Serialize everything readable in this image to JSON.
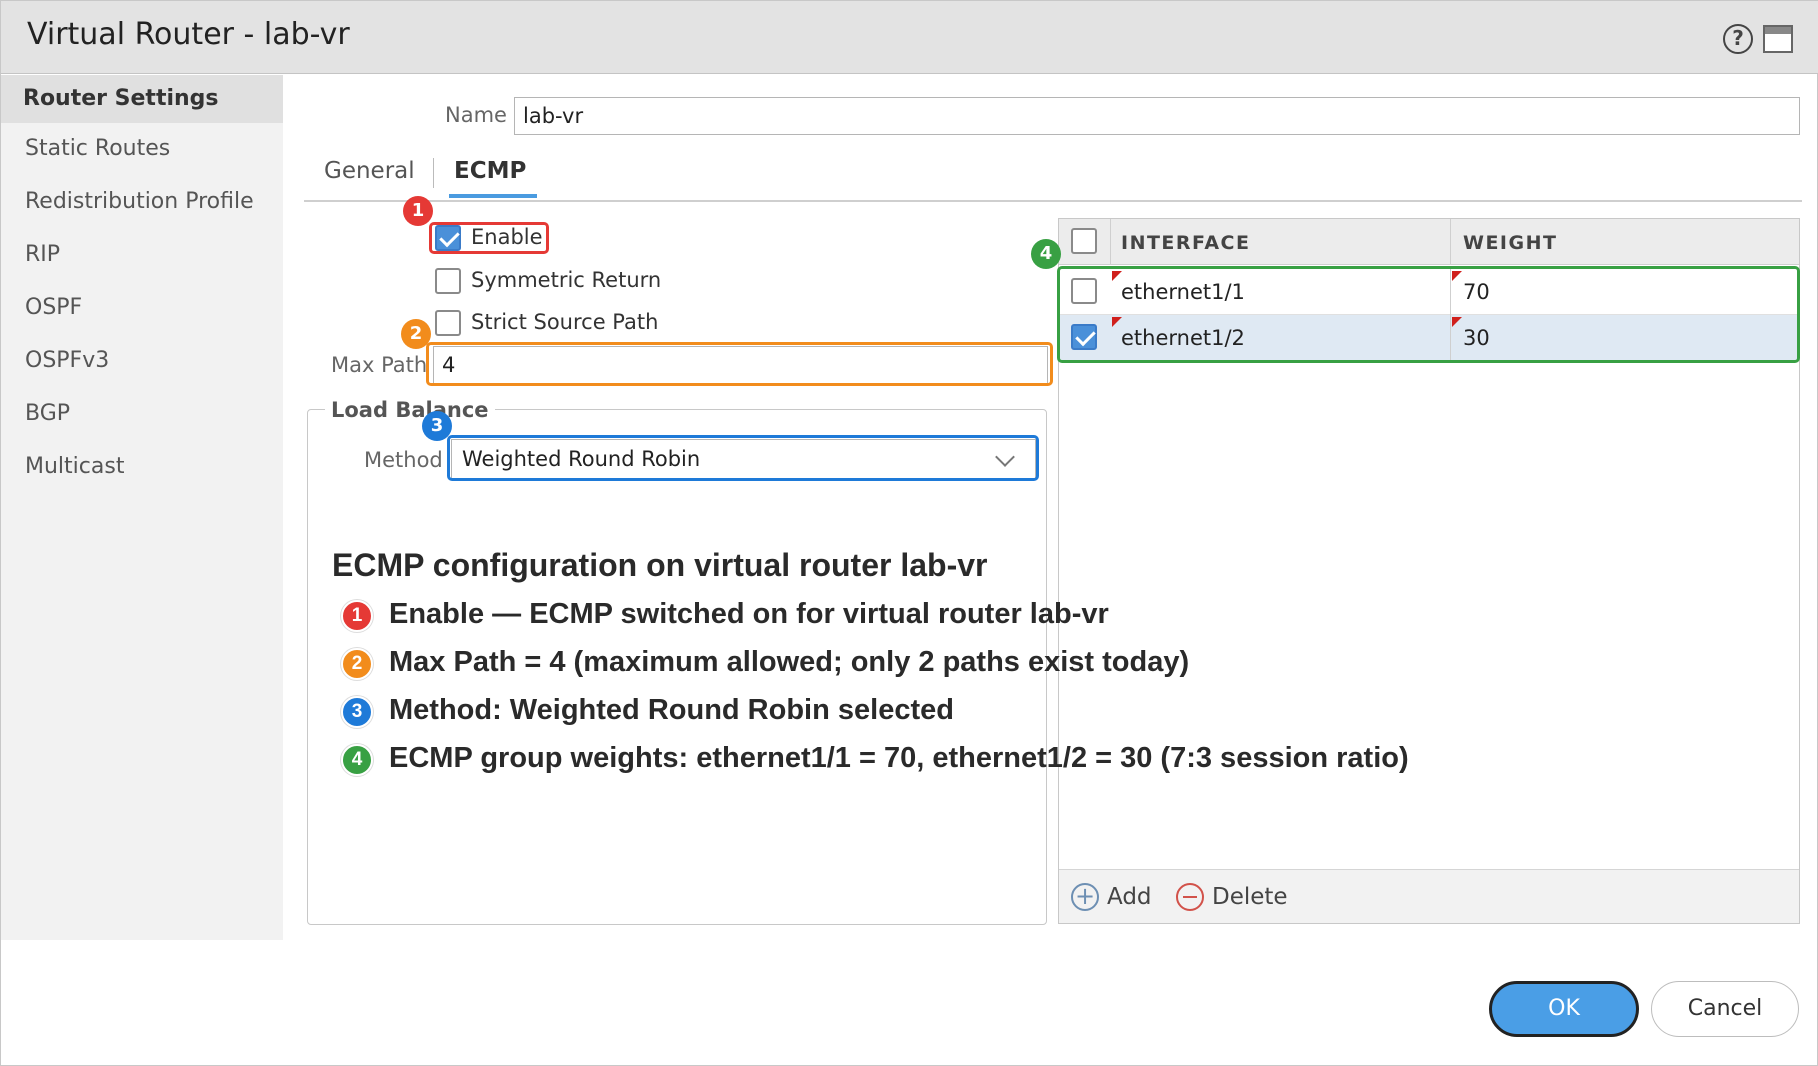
{
  "window": {
    "title": "Virtual Router - lab-vr",
    "help_glyph": "?"
  },
  "sidebar": {
    "items": [
      {
        "label": "Router Settings",
        "active": true
      },
      {
        "label": "Static Routes"
      },
      {
        "label": "Redistribution Profile"
      },
      {
        "label": "RIP"
      },
      {
        "label": "OSPF"
      },
      {
        "label": "OSPFv3"
      },
      {
        "label": "BGP"
      },
      {
        "label": "Multicast"
      }
    ]
  },
  "form": {
    "name_label": "Name",
    "name_value": "lab-vr",
    "tabs": [
      {
        "label": "General"
      },
      {
        "label": "ECMP",
        "active": true
      }
    ],
    "ecmp": {
      "enable_label": "Enable",
      "enable_checked": true,
      "symmetric_return_label": "Symmetric Return",
      "symmetric_return_checked": false,
      "strict_source_path_label": "Strict Source Path",
      "strict_source_path_checked": false,
      "max_path_label": "Max Path",
      "max_path_value": "4",
      "load_balance_legend": "Load Balance",
      "method_label": "Method",
      "method_value": "Weighted Round Robin"
    }
  },
  "interface_table": {
    "columns": [
      "INTERFACE",
      "WEIGHT"
    ],
    "rows": [
      {
        "interface": "ethernet1/1",
        "weight": "70",
        "checked": false
      },
      {
        "interface": "ethernet1/2",
        "weight": "30",
        "checked": true
      }
    ],
    "add_label": "Add",
    "delete_label": "Delete"
  },
  "annotations": {
    "title": "ECMP configuration on virtual router lab-vr",
    "items": [
      {
        "num": "1",
        "text": "Enable — ECMP switched on for virtual router lab-vr",
        "color": "#e53935"
      },
      {
        "num": "2",
        "text": "Max Path = 4 (maximum allowed; only 2 paths exist today)",
        "color": "#f28c1c"
      },
      {
        "num": "3",
        "text": "Method: Weighted Round Robin selected",
        "color": "#1e7ad8"
      },
      {
        "num": "4",
        "text": "ECMP group weights: ethernet1/1 = 70, ethernet1/2 = 30  (7:3 session ratio)",
        "color": "#38a043"
      }
    ]
  },
  "footer": {
    "ok_label": "OK",
    "cancel_label": "Cancel"
  },
  "colors": {
    "accent": "#4a9ee6",
    "highlight_red": "#e53935",
    "highlight_orange": "#f28c1c",
    "highlight_blue": "#1e7ad8",
    "highlight_green": "#38a043"
  }
}
